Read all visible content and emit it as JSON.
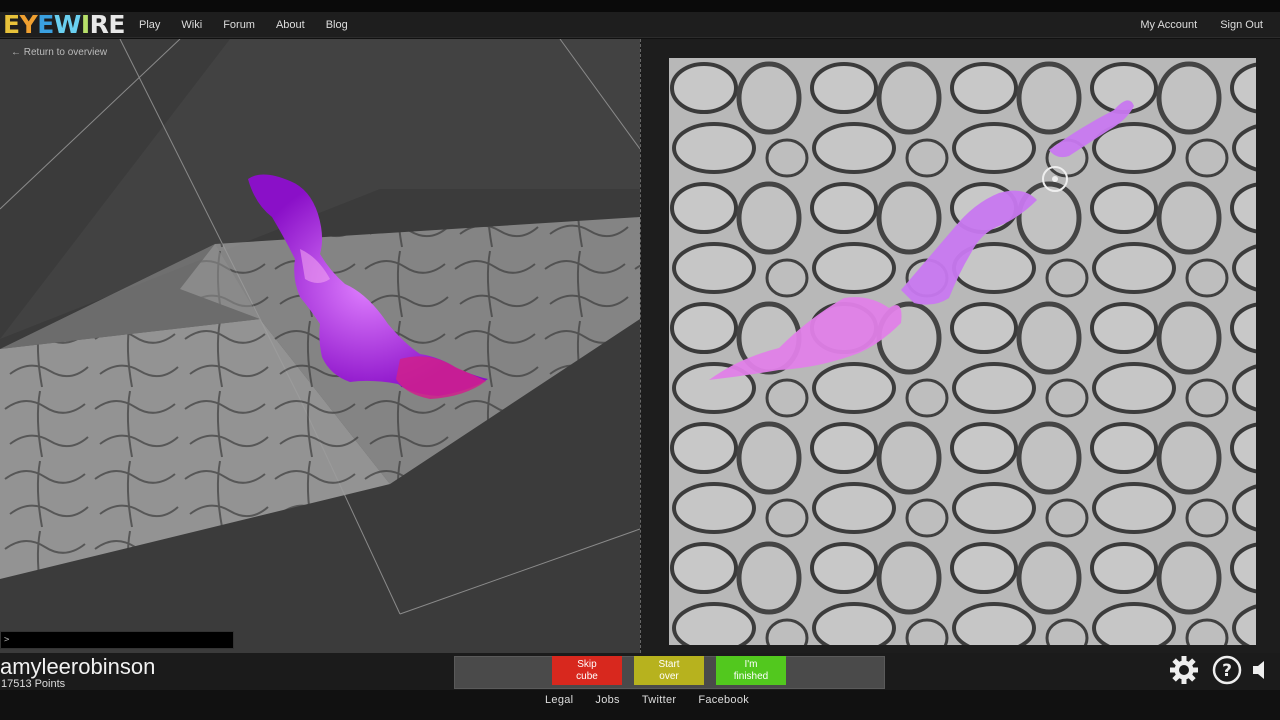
{
  "nav": {
    "logo": "EYEWIRE",
    "links": [
      "Play",
      "Wiki",
      "Forum",
      "About",
      "Blog"
    ],
    "account": "My Account",
    "signout": "Sign Out"
  },
  "viewer": {
    "return_link": "← Return to overview",
    "console_prompt": ">"
  },
  "player": {
    "username": "amyleerobinson",
    "points": "17513",
    "points_label": "Points"
  },
  "buttons": {
    "skip": [
      "Skip",
      "cube"
    ],
    "start_over": [
      "Start",
      "over"
    ],
    "finished": [
      "I'm",
      "finished"
    ]
  },
  "footer": [
    "Legal",
    "Jobs",
    "Twitter",
    "Facebook"
  ],
  "icons": {
    "settings": "gear-icon",
    "help": "help-icon",
    "sound": "speaker-icon"
  },
  "colors": {
    "segment_purple": "#b040e0",
    "segment_magenta": "#d050c8",
    "skip": "#d8281e",
    "start_over": "#b7b21e",
    "finished": "#52c81e"
  }
}
